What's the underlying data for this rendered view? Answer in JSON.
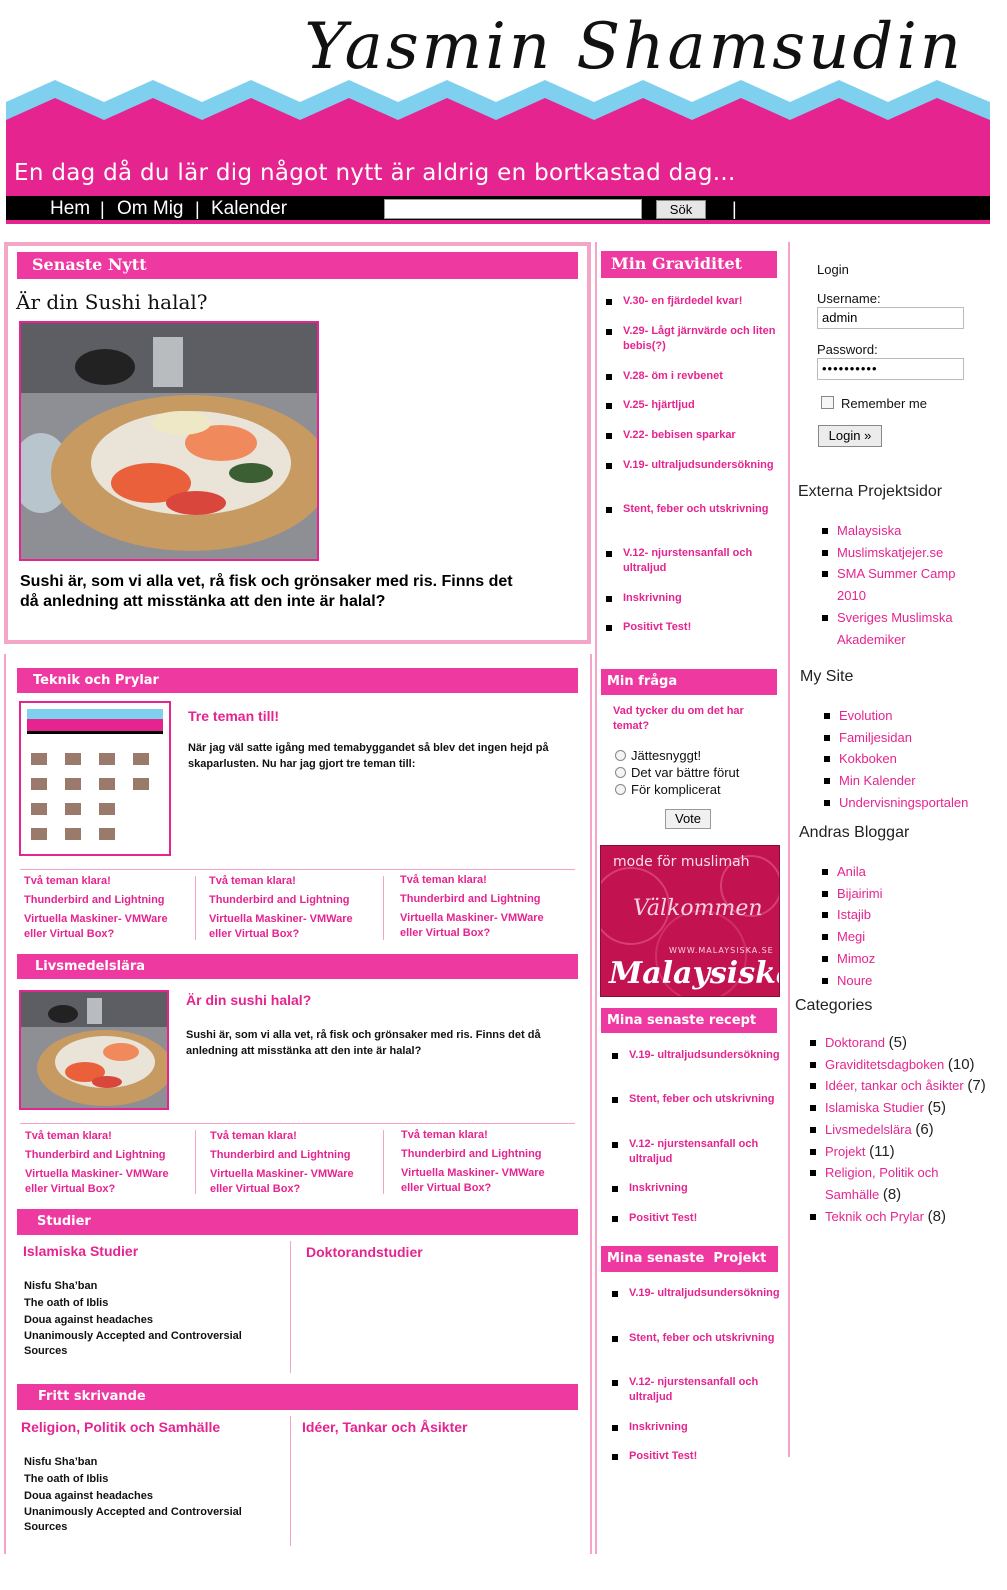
{
  "header": {
    "site_title": "Yasmin Shamsudin",
    "tagline": "En dag då du lär dig något nytt är aldrig en bortkastad dag...",
    "colors": {
      "pink": "#e5248f",
      "blue": "#7fd0ef",
      "black": "#000000"
    }
  },
  "nav": {
    "items": [
      "Hem",
      "Om Mig",
      "Kalender"
    ],
    "separator": "|",
    "search_button": "Sök"
  },
  "featured": {
    "heading": "Senaste Nytt",
    "post_title": "Är din Sushi halal?",
    "post_text": "Sushi är, som vi alla vet, rå fisk och grönsaker med ris. Finns det då anledning att misstänka att den inte är halal?"
  },
  "teknik": {
    "heading": "Teknik och Prylar",
    "post_title": "Tre teman till!",
    "post_text": "När jag väl satte igång med temabyggandet så blev det ingen hejd på skaparlusten. Nu har jag gjort tre teman till:",
    "link_columns": [
      [
        "Två teman klara!",
        "Thunderbird and Lightning",
        "Virtuella Maskiner- VMWare eller Virtual Box?"
      ],
      [
        "Två teman klara!",
        "Thunderbird and Lightning",
        "Virtuella Maskiner- VMWare eller Virtual Box?"
      ],
      [
        "Två teman klara!",
        "Thunderbird and Lightning",
        "Virtuella Maskiner- VMWare eller Virtual Box?"
      ]
    ]
  },
  "livsmedel": {
    "heading": "Livsmedelslära",
    "post_title": "Är din sushi halal?",
    "post_text": "Sushi är, som vi alla vet, rå fisk och grönsaker med ris. Finns det då anledning att misstänka att den inte är halal?",
    "link_columns": [
      [
        "Två teman klara!",
        "Thunderbird and Lightning",
        "Virtuella Maskiner- VMWare eller Virtual Box?"
      ],
      [
        "Två teman klara!",
        "Thunderbird and Lightning",
        "Virtuella Maskiner- VMWare eller Virtual Box?"
      ],
      [
        "Två teman klara!",
        "Thunderbird and Lightning",
        "Virtuella Maskiner- VMWare eller Virtual Box?"
      ]
    ]
  },
  "studier": {
    "heading": "Studier",
    "left_title": "Islamiska Studier",
    "right_title": "Doktorandstudier",
    "items": [
      "Nisfu Sha’ban",
      "The oath of Iblis",
      "Doua against headaches",
      "Unanimously Accepted and Controversial Sources"
    ]
  },
  "fritt": {
    "heading": "Fritt skrivande",
    "left_title": "Religion, Politik och Samhälle",
    "right_title": "Idéer, Tankar och Åsikter",
    "items": [
      "Nisfu Sha’ban",
      "The oath of Iblis",
      "Doua against headaches",
      "Unanimously Accepted and Controversial Sources"
    ]
  },
  "graviditet": {
    "heading": "Min Graviditet",
    "items": [
      "V.30- en fjärdedel kvar!",
      "V.29- Lågt järnvärde och liten bebis(?)",
      "V.28- öm i revbenet",
      "V.25- hjärtljud",
      "V.22- bebisen sparkar",
      "V.19- ultraljudsundersökning",
      "Stent, feber och utskrivning",
      "V.12- njurstensanfall och ultraljud",
      "Inskrivning",
      "Positivt Test!"
    ]
  },
  "poll": {
    "heading": "Min fråga",
    "question": "Vad tycker du om det har temat?",
    "options": [
      "Jättesnyggt!",
      "Det var bättre förut",
      "För komplicerat"
    ],
    "vote_label": "Vote"
  },
  "banner": {
    "line1": "mode för muslimah",
    "line2": "Välkommen",
    "url": "WWW.MALAYSISKA.SE",
    "brand": "Malaysiska"
  },
  "recept": {
    "heading": "Mina senaste recept",
    "items": [
      "V.19- ultraljudsundersökning",
      "Stent, feber och utskrivning",
      "V.12- njurstensanfall och ultraljud",
      "Inskrivning",
      "Positivt Test!"
    ]
  },
  "projekt": {
    "heading": "Mina senaste  Projekt",
    "items": [
      "V.19- ultraljudsundersökning",
      "Stent, feber och utskrivning",
      "V.12- njurstensanfall och ultraljud",
      "Inskrivning",
      "Positivt Test!"
    ]
  },
  "login": {
    "heading": "Login",
    "username_label": "Username:",
    "username_value": "admin",
    "password_label": "Password:",
    "password_value": "••••••••••",
    "remember_label": "Remember me",
    "button": "Login »"
  },
  "externa": {
    "heading": "Externa Projektsidor",
    "items": [
      "Malaysiska",
      "Muslimskatjejer.se",
      "SMA Summer Camp 2010",
      "Sveriges Muslimska Akademiker"
    ]
  },
  "mysite": {
    "heading": "My Site",
    "items": [
      "Evolution",
      "Familjesidan",
      "Kokboken",
      "Min Kalender",
      "Undervisningsportalen"
    ]
  },
  "bloggar": {
    "heading": "Andras Bloggar",
    "items": [
      "Anila",
      "Bijairimi",
      "Istajib",
      "Megi",
      "Mimoz",
      "Noure"
    ]
  },
  "categories": {
    "heading": "Categories",
    "items": [
      {
        "name": "Doktorand",
        "count": "(5)"
      },
      {
        "name": "Graviditetsdagboken",
        "count": "(10)"
      },
      {
        "name": "Idéer, tankar och åsikter",
        "count": "(7)"
      },
      {
        "name": "Islamiska Studier",
        "count": "(5)"
      },
      {
        "name": "Livsmedelslära",
        "count": "(6)"
      },
      {
        "name": "Projekt",
        "count": "(11)"
      },
      {
        "name": "Religion, Politik och Samhälle",
        "count": "(8)"
      },
      {
        "name": "Teknik och Prylar",
        "count": "(8)"
      }
    ]
  }
}
